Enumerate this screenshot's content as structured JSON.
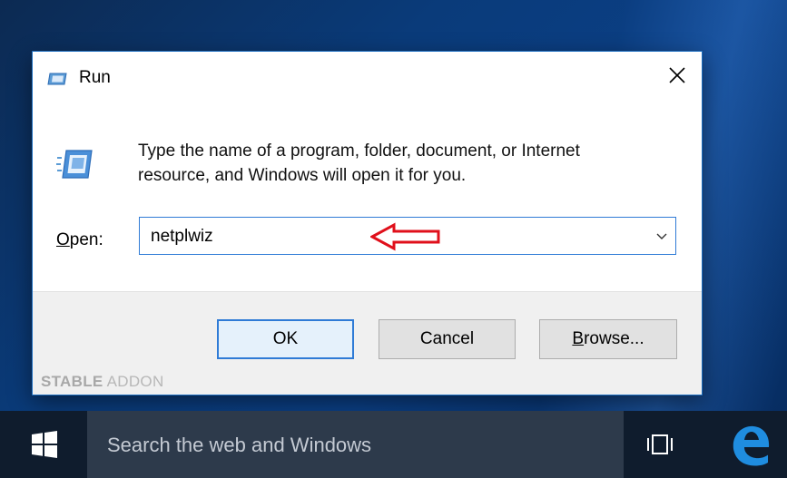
{
  "dialog": {
    "title": "Run",
    "description_line1": "Type the name of a program, folder, document, or Internet",
    "description_line2": "resource, and Windows will open it for you.",
    "open_label_accel": "O",
    "open_label_rest": "pen:",
    "open_value": "netplwiz",
    "buttons": {
      "ok": "OK",
      "cancel": "Cancel",
      "browse_accel": "B",
      "browse_rest": "rowse..."
    }
  },
  "watermark": {
    "bold": "STABLE",
    "rest": " ADDON"
  },
  "taskbar": {
    "search_placeholder": "Search the web and Windows"
  },
  "colors": {
    "accent": "#2f7bd6",
    "annotation_arrow": "#e0101b",
    "taskbar": "#0f1c2d",
    "search_box": "#2d3a4b"
  },
  "icons": {
    "title": "run-icon",
    "close": "close-icon",
    "dropdown": "chevron-down-icon",
    "start": "windows-logo-icon",
    "task_view": "task-view-icon",
    "edge": "edge-browser-icon"
  }
}
